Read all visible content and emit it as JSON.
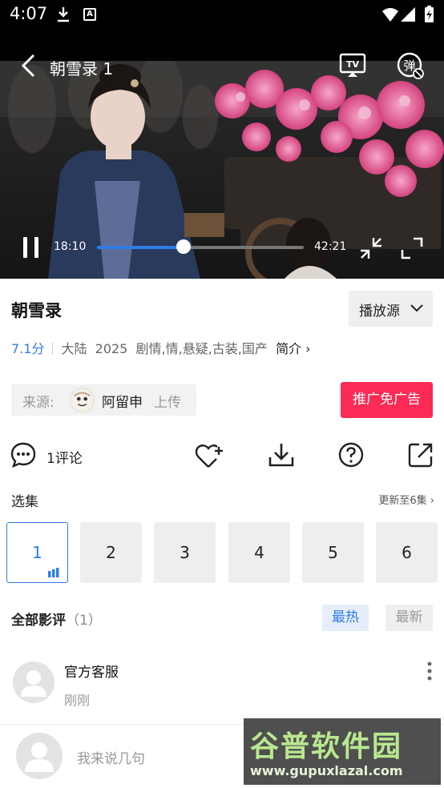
{
  "status_bar": {
    "time": "4:07"
  },
  "video": {
    "title": "朝雪录 1",
    "current_time": "18:10",
    "total_time": "42:21",
    "progress": 0.42
  },
  "info": {
    "title": "朝雪录",
    "source_button": "播放源",
    "score": "7.1分",
    "region": "大陆",
    "year": "2025",
    "genres": "剧情,情,悬疑,古装,国产",
    "intro_link": "简介"
  },
  "uploader": {
    "label": "来源:",
    "name": "阿留申",
    "upload_label": "上传"
  },
  "promo_button": "推广免广告",
  "actions": {
    "comment_count": "1评论"
  },
  "episodes": {
    "header": "选集",
    "update_status": "更新至6集",
    "items": [
      "1",
      "2",
      "3",
      "4",
      "5",
      "6"
    ],
    "active_index": 0
  },
  "reviews": {
    "header": "全部影评",
    "count": "（1）",
    "sort_hot": "最热",
    "sort_new": "最新"
  },
  "comment": {
    "author": "官方客服",
    "time": "刚刚"
  },
  "composer": {
    "placeholder": "我来说几句"
  },
  "watermark": {
    "title": "谷普软件园",
    "url": "www.gupuxlazal.com"
  },
  "colors": {
    "accent": "#2f7ce8",
    "promo": "#fb2b55"
  }
}
